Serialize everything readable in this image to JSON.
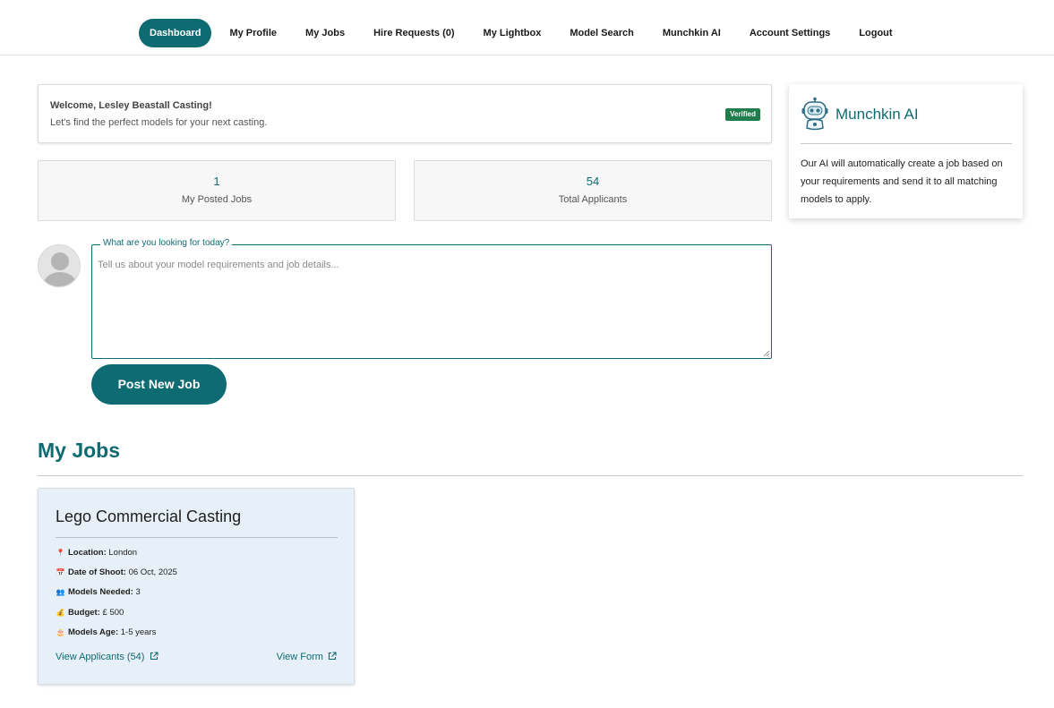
{
  "nav": {
    "items": [
      {
        "label": "Dashboard",
        "active": true
      },
      {
        "label": "My Profile"
      },
      {
        "label": "My Jobs"
      },
      {
        "label": "Hire Requests (0)"
      },
      {
        "label": "My Lightbox"
      },
      {
        "label": "Model Search"
      },
      {
        "label": "Munchkin AI"
      },
      {
        "label": "Account Settings"
      },
      {
        "label": "Logout"
      }
    ]
  },
  "welcome": {
    "title": "Welcome, Lesley Beastall Casting!",
    "subtitle": "Let's find the perfect models for your next casting.",
    "badge": "Verified"
  },
  "stats": [
    {
      "value": "1",
      "label": "My Posted Jobs"
    },
    {
      "value": "54",
      "label": "Total Applicants"
    }
  ],
  "composer": {
    "legend": "What are you looking for today?",
    "placeholder": "Tell us about your model requirements and job details...",
    "value": "",
    "post_label": "Post New Job"
  },
  "my_jobs": {
    "title": "My Jobs",
    "jobs": [
      {
        "title": "Lego Commercial Casting",
        "location_label": "Location:",
        "location": "London",
        "date_label": "Date of Shoot:",
        "date": "06 Oct, 2025",
        "models_label": "Models Needed:",
        "models": "3",
        "budget_label": "Budget:",
        "budget": "£ 500",
        "age_label": "Models Age:",
        "age": "1-5 years",
        "view_applicants": "View Applicants (54)",
        "view_form": "View Form"
      }
    ]
  },
  "ai_panel": {
    "title": "Munchkin AI",
    "description": "Our AI will automatically create a job based on your requirements and send it to all matching models to apply."
  },
  "icons": {
    "location": "pin-icon",
    "date": "calendar-icon",
    "models": "people-icon",
    "budget": "money-bag-icon",
    "age": "cake-icon",
    "external": "external-link-icon",
    "ai": "robot-icon"
  },
  "colors": {
    "brand": "#0f6b72",
    "verified": "#1e7d4a",
    "card_bg": "#e7f0f8"
  }
}
